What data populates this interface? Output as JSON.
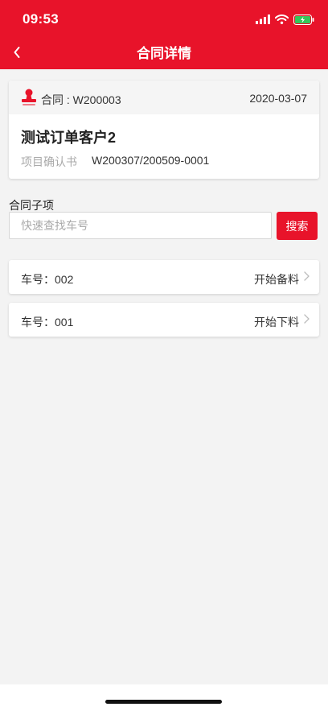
{
  "status_bar": {
    "time": "09:53"
  },
  "nav": {
    "title": "合同详情",
    "back_icon": "chevron-left-icon"
  },
  "contract": {
    "icon": "stamp-icon",
    "number": "合同 : W200003",
    "date": "2020-03-07",
    "customer": "测试订单客户2",
    "project_label": "项目确认书",
    "project_value": "W200307/200509-0001"
  },
  "sub_items": {
    "title": "合同子项",
    "search_placeholder": "快速查找车号",
    "search_value": "",
    "search_button": "搜索",
    "items": [
      {
        "label": "车号：002",
        "status": "开始备料"
      },
      {
        "label": "车号：001",
        "status": "开始下料"
      }
    ]
  },
  "colors": {
    "brand_red": "#e8132a",
    "background": "#f3f3f3",
    "battery_green": "#34c759"
  }
}
